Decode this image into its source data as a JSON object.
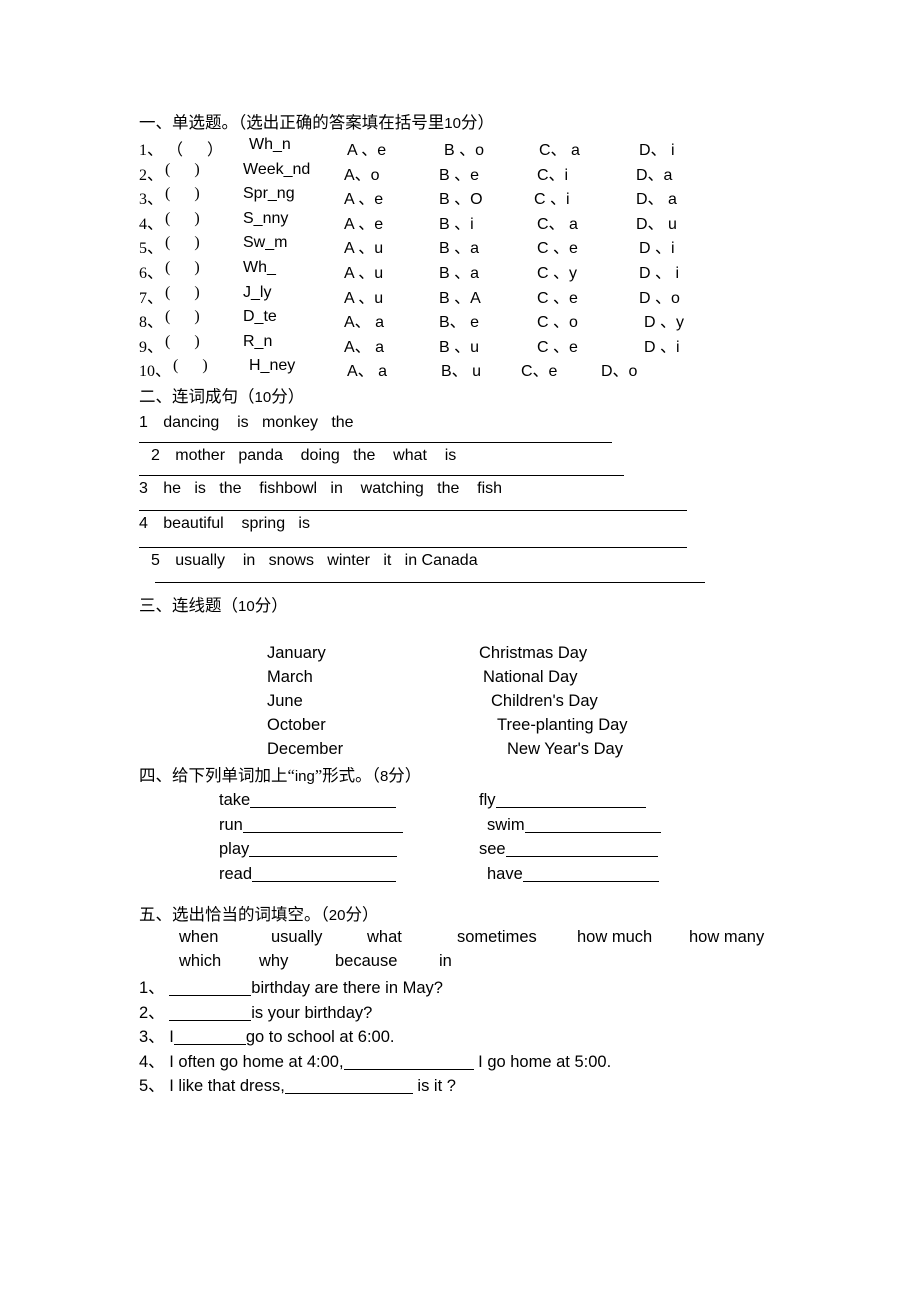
{
  "document": {
    "title": "English exam worksheet"
  },
  "section1": {
    "heading": "一、单选题。（选出正确的答案填在括号里",
    "heading_score": "10",
    "heading_tail": "分）",
    "questions": [
      {
        "num": "1、",
        "paren": "（      ）",
        "word": "Wh_n",
        "options": [
          "A 、e",
          "B 、o",
          "C、 a",
          "D、 i"
        ]
      },
      {
        "num": "2、",
        "paren": "(      )",
        "word": "Week_nd",
        "options": [
          "A、o",
          "B 、e",
          "C、i",
          "D、a"
        ]
      },
      {
        "num": "3、",
        "paren": "(      )",
        "word": "Spr_ng",
        "options": [
          "A 、e",
          "B 、O",
          "C 、i",
          "D、 a"
        ]
      },
      {
        "num": "4、",
        "paren": "(      )",
        "word": "S_nny",
        "options": [
          "A 、e",
          "B 、i",
          "C、 a",
          "D、 u"
        ]
      },
      {
        "num": "5、",
        "paren": "(      )",
        "word": "Sw_m",
        "options": [
          "A 、u",
          "B 、a",
          "C 、e",
          "D 、i"
        ]
      },
      {
        "num": "6、",
        "paren": "(      )",
        "word": "Wh_",
        "options": [
          "A 、u",
          "B 、a",
          "C 、y",
          "D 、 i"
        ]
      },
      {
        "num": "7、",
        "paren": "(      )",
        "word": "J_ly",
        "options": [
          "A 、u",
          "B 、A",
          "C 、e",
          "D 、o"
        ]
      },
      {
        "num": "8、",
        "paren": "(      )",
        "word": "D_te",
        "options": [
          "A、 a",
          "B、 e",
          "C 、o",
          "D 、y"
        ]
      },
      {
        "num": "9、",
        "paren": "(      )",
        "word": "R_n",
        "options": [
          "A、 a",
          "B 、u",
          "C 、e",
          "D 、i"
        ]
      },
      {
        "num": "10、",
        "paren": "(      )",
        "word": "H_ney",
        "options": [
          "A、 a",
          "B、 u",
          "C、e",
          "D、o"
        ]
      }
    ]
  },
  "section2": {
    "heading": "二、连词成句（",
    "heading_score": "10",
    "heading_tail": "分）",
    "items": [
      {
        "num": "1",
        "words": "dancing    is   monkey   the"
      },
      {
        "num": "2",
        "words": "mother   panda    doing   the    what    is"
      },
      {
        "num": "3",
        "words": "he   is   the    fishbowl   in    watching   the    fish"
      },
      {
        "num": "4",
        "words": "beautiful    spring   is"
      },
      {
        "num": "5",
        "words": "usually    in   snows   winter   it   in Canada"
      }
    ]
  },
  "section3": {
    "heading": "三、连线题（",
    "heading_score": "10",
    "heading_tail": "分）",
    "left_column": [
      "January",
      "March",
      "June",
      "October",
      "December"
    ],
    "right_column": [
      "Christmas Day",
      "National Day",
      "Children's Day",
      "Tree-planting Day",
      "New Year's Day"
    ]
  },
  "section4": {
    "heading_a": "四、给下列单词加上“",
    "heading_ing": "ing",
    "heading_b": "”形式。（",
    "heading_score": "8",
    "heading_tail": "分）",
    "left_words": [
      "take",
      "run",
      "play",
      "read"
    ],
    "right_words": [
      "fly",
      "swim",
      "see",
      "have"
    ]
  },
  "section5": {
    "heading": "五、选出恰当的词填空。（",
    "heading_score": "20",
    "heading_tail": "分）",
    "word_bank_row1": [
      "when",
      "usually",
      "what",
      "sometimes",
      "how much",
      "how many"
    ],
    "word_bank_row2": [
      "which",
      "why",
      "because",
      "in"
    ],
    "questions": [
      {
        "num": "1、",
        "before": "",
        "after": "birthday are there in May?"
      },
      {
        "num": "2、",
        "before": "",
        "after": "is your birthday?"
      },
      {
        "num": "3、",
        "before": "I",
        "after": "go to school at 6:00."
      },
      {
        "num": "4、",
        "before": "I often go home at 4:00,",
        "after": " I go home at 5:00."
      },
      {
        "num": "5、",
        "before": "I like that dress,",
        "after": " is it ?"
      }
    ]
  }
}
